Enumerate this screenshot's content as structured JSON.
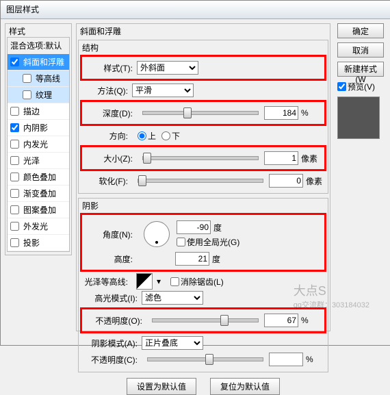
{
  "title": "图层样式",
  "stylesPanel": {
    "header": "样式",
    "blendLabel": "混合选项:默认",
    "items": [
      {
        "label": "斜面和浮雕",
        "checked": true,
        "selected": true
      },
      {
        "label": "等高线",
        "checked": false,
        "indent": true,
        "sub": true
      },
      {
        "label": "纹理",
        "checked": false,
        "indent": true,
        "sub": true
      },
      {
        "label": "描边",
        "checked": false
      },
      {
        "label": "内阴影",
        "checked": true
      },
      {
        "label": "内发光",
        "checked": false
      },
      {
        "label": "光泽",
        "checked": false
      },
      {
        "label": "颜色叠加",
        "checked": false
      },
      {
        "label": "渐变叠加",
        "checked": false
      },
      {
        "label": "图案叠加",
        "checked": false
      },
      {
        "label": "外发光",
        "checked": false
      },
      {
        "label": "投影",
        "checked": false
      }
    ]
  },
  "main": {
    "title": "斜面和浮雕",
    "structure": {
      "title": "结构",
      "styleLabel": "样式(T):",
      "styleValue": "外斜面",
      "techLabel": "方法(Q):",
      "techValue": "平滑",
      "depthLabel": "深度(D):",
      "depthValue": "184",
      "depthUnit": "%",
      "dirLabel": "方向:",
      "dirUp": "上",
      "dirDown": "下",
      "sizeLabel": "大小(Z):",
      "sizeValue": "1",
      "sizeUnit": "像素",
      "softenLabel": "软化(F):",
      "softenValue": "0",
      "softenUnit": "像素"
    },
    "shading": {
      "title": "阴影",
      "angleLabel": "角度(N):",
      "angleValue": "-90",
      "angleUnit": "度",
      "globalLight": "使用全局光(G)",
      "altLabel": "高度:",
      "altValue": "21",
      "altUnit": "度",
      "glossLabel": "光泽等高线:",
      "antiAlias": "消除锯齿(L)",
      "hlModeLabel": "高光模式(I):",
      "hlModeValue": "滤色",
      "hlOpacityLabel": "不透明度(O):",
      "hlOpacityValue": "67",
      "hlOpacityUnit": "%",
      "shModeLabel": "阴影模式(A):",
      "shModeValue": "正片叠底",
      "shOpacityLabel": "不透明度(C):",
      "shOpacityValue": "",
      "shOpacityUnit": "%"
    },
    "buttons": {
      "makeDefault": "设置为默认值",
      "resetDefault": "复位为默认值"
    }
  },
  "rightPanel": {
    "ok": "确定",
    "cancel": "取消",
    "newStyle": "新建样式(W",
    "preview": "预览(V)"
  },
  "watermark": {
    "big": "大点S",
    "small": "qq交流群：303184032"
  }
}
